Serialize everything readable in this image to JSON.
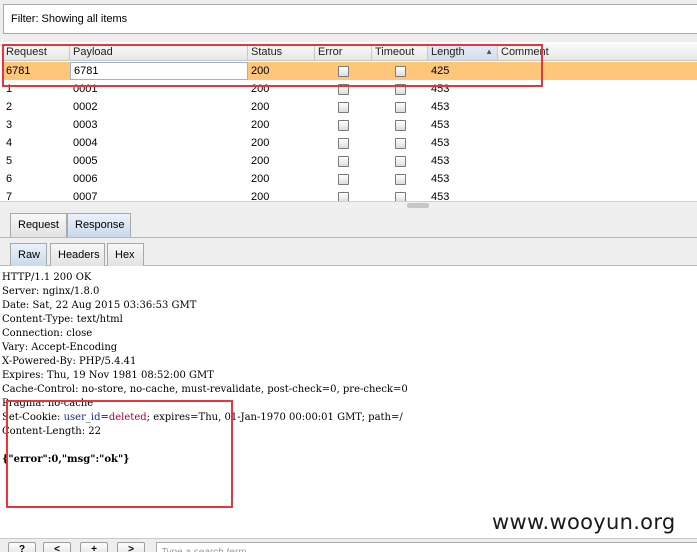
{
  "filter": {
    "text": "Filter: Showing all items"
  },
  "table": {
    "columns": [
      "Request",
      "Payload",
      "Status",
      "Error",
      "Timeout",
      "Length",
      "Comment"
    ],
    "sorted_column": "Length",
    "rows": [
      {
        "request": "6781",
        "payload": "6781",
        "status": "200",
        "length": "425",
        "selected": true
      },
      {
        "request": "1",
        "payload": "0001",
        "status": "200",
        "length": "453"
      },
      {
        "request": "2",
        "payload": "0002",
        "status": "200",
        "length": "453"
      },
      {
        "request": "3",
        "payload": "0003",
        "status": "200",
        "length": "453"
      },
      {
        "request": "4",
        "payload": "0004",
        "status": "200",
        "length": "453"
      },
      {
        "request": "5",
        "payload": "0005",
        "status": "200",
        "length": "453"
      },
      {
        "request": "6",
        "payload": "0006",
        "status": "200",
        "length": "453"
      },
      {
        "request": "7",
        "payload": "0007",
        "status": "200",
        "length": "453"
      }
    ]
  },
  "message_tabs": {
    "request": "Request",
    "response": "Response",
    "active": "Response"
  },
  "view_tabs": {
    "raw": "Raw",
    "headers": "Headers",
    "hex": "Hex",
    "active": "Raw"
  },
  "response": {
    "lines": [
      "HTTP/1.1 200 OK",
      "Server: nginx/1.8.0",
      "Date: Sat, 22 Aug 2015 03:36:53 GMT",
      "Content-Type: text/html",
      "Connection: close",
      "Vary: Accept-Encoding",
      "X-Powered-By: PHP/5.4.41",
      "Expires: Thu, 19 Nov 1981 08:52:00 GMT",
      "Cache-Control: no-store, no-cache, must-revalidate, post-check=0, pre-check=0",
      "Pragma: no-cache"
    ],
    "cookie_prefix": "Set-Cookie: ",
    "cookie_name": "user_id",
    "cookie_eq": "=",
    "cookie_value": "deleted",
    "cookie_rest": "; expires=Thu, 01-Jan-1970 00:00:01 GMT; path=/",
    "content_length": "Content-Length: 22",
    "body": "{\"error\":0,\"msg\":\"ok\"}"
  },
  "watermark": "www.wooyun.org",
  "bottom_bar": {
    "help_label": "?",
    "prev_label": "<",
    "add_label": "+",
    "next_label": ">",
    "search_placeholder": "Type a search term"
  },
  "colors": {
    "selected_row": "#fdc679",
    "highlight_box": "#e8343a",
    "cookie_name": "#1a2b8a",
    "cookie_value": "#b5002f"
  }
}
